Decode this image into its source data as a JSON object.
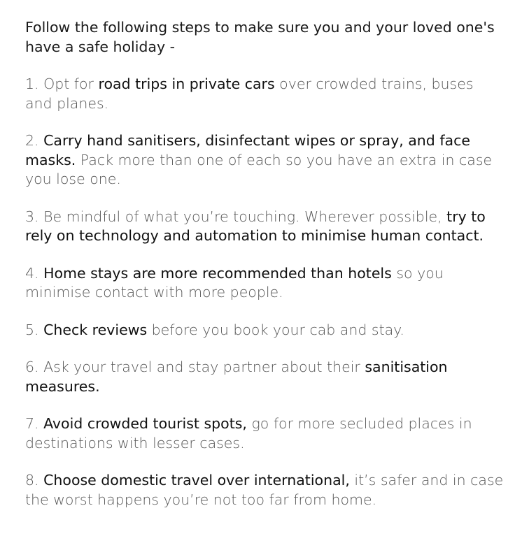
{
  "intro": "Follow the following steps to make sure you and your loved one's have a safe holiday -",
  "steps": [
    {
      "number": "1.",
      "parts": [
        {
          "text": "Opt for ",
          "em": false
        },
        {
          "text": "road trips in private cars",
          "em": true
        },
        {
          "text": " over crowded trains, buses and planes.",
          "em": false
        }
      ]
    },
    {
      "number": "2.",
      "parts": [
        {
          "text": "Carry hand sanitisers, disinfectant wipes or spray, and face masks.",
          "em": true
        },
        {
          "text": " Pack more than one of each so you have an extra in case you lose one.",
          "em": false
        }
      ]
    },
    {
      "number": "3.",
      "parts": [
        {
          "text": "Be mindful of what you’re touching. Wherever possible, ",
          "em": false
        },
        {
          "text": "try to rely on technology and automation to minimise human contact.",
          "em": true
        }
      ]
    },
    {
      "number": "4.",
      "parts": [
        {
          "text": "Home stays are more recommended than hotels",
          "em": true
        },
        {
          "text": " so you minimise contact with more people.",
          "em": false
        }
      ]
    },
    {
      "number": "5.",
      "parts": [
        {
          "text": "Check reviews",
          "em": true
        },
        {
          "text": " before you book your cab and stay.",
          "em": false
        }
      ]
    },
    {
      "number": "6.",
      "parts": [
        {
          "text": "Ask your travel and stay partner about their ",
          "em": false
        },
        {
          "text": "sanitisation measures.",
          "em": true
        }
      ]
    },
    {
      "number": "7.",
      "parts": [
        {
          "text": "Avoid crowded tourist spots,",
          "em": true
        },
        {
          "text": " go for more secluded places in destinations with lesser cases.",
          "em": false
        }
      ]
    },
    {
      "number": "8.",
      "parts": [
        {
          "text": "Choose domestic travel over international,",
          "em": true
        },
        {
          "text": " it’s safer and in case the worst happens you’re not too far from home.",
          "em": false
        }
      ]
    }
  ]
}
